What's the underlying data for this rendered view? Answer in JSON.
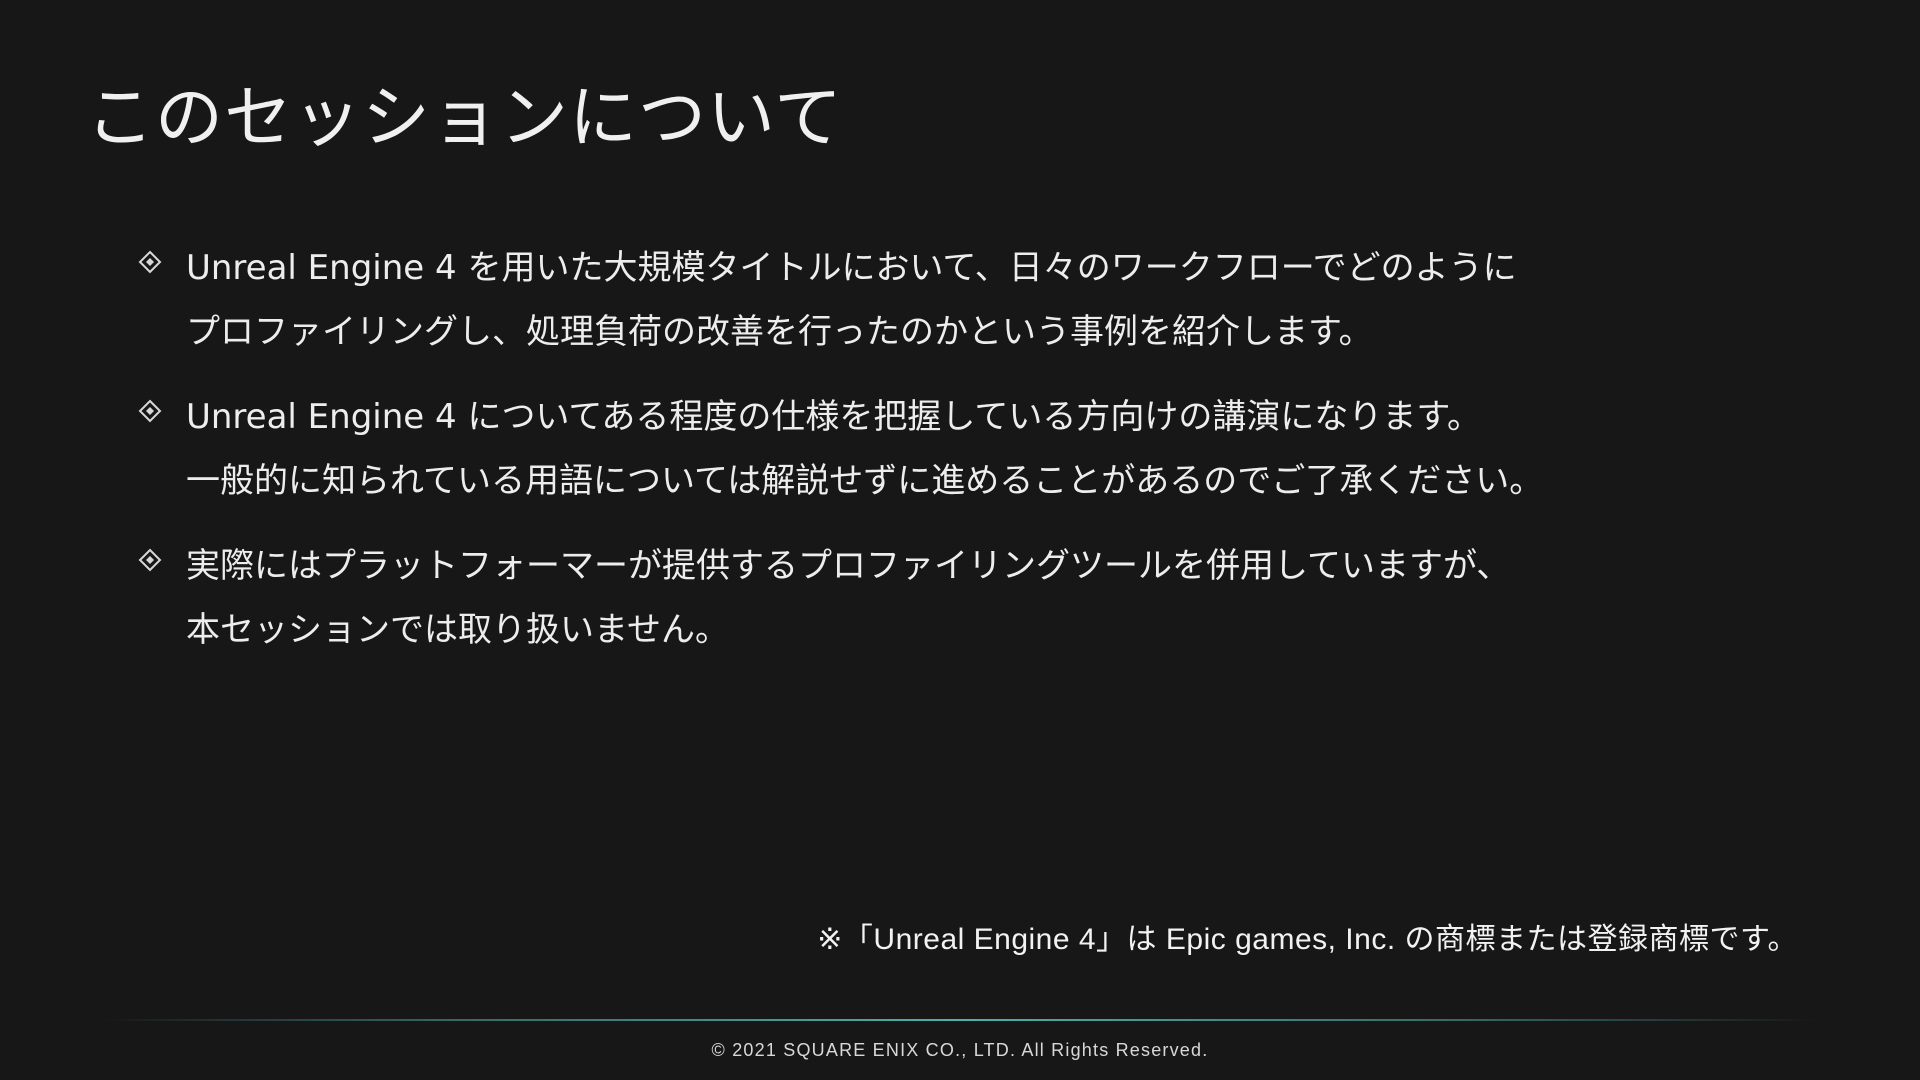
{
  "slide": {
    "title": "このセッションについて",
    "bullets": [
      {
        "icon": "diamond-bullet-icon",
        "lines": [
          "Unreal Engine 4 を用いた大規模タイトルにおいて、日々のワークフローでどのように",
          "プロファイリングし、処理負荷の改善を行ったのかという事例を紹介します。"
        ]
      },
      {
        "icon": "diamond-bullet-icon",
        "lines": [
          "Unreal Engine 4 についてある程度の仕様を把握している方向けの講演になります。",
          "一般的に知られている用語については解説せずに進めることがあるのでご了承ください。"
        ]
      },
      {
        "icon": "diamond-bullet-icon",
        "lines": [
          "実際にはプラットフォーマーが提供するプロファイリングツールを併用していますが、",
          "本セッションでは取り扱いません。"
        ]
      }
    ],
    "trademark_note": "※「Unreal Engine 4」は Epic games, Inc. の商標または登録商標です。",
    "copyright": "© 2021 SQUARE ENIX CO., LTD. All Rights Reserved."
  },
  "colors": {
    "background": "#171717",
    "text": "#ececec",
    "accent_rule": "#4fb0ac"
  }
}
